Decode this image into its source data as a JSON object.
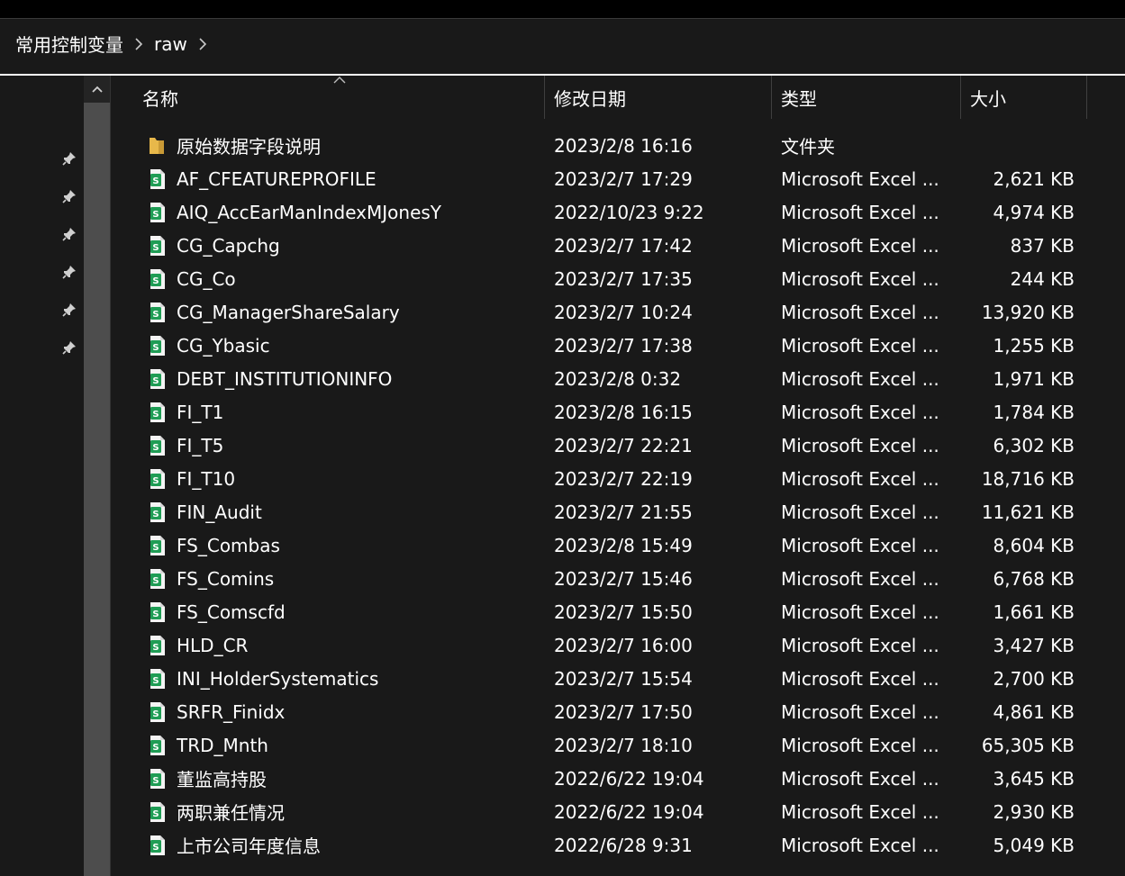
{
  "breadcrumb": {
    "items": [
      "常用控制变量",
      "raw"
    ]
  },
  "columns": {
    "name": "名称",
    "date": "修改日期",
    "type": "类型",
    "size": "大小"
  },
  "colors": {
    "background": "#191919",
    "excel_green": "#1f9d55",
    "folder_yellow": "#e8b84a"
  },
  "files": [
    {
      "name": "原始数据字段说明",
      "date": "2023/2/8 16:16",
      "type": "文件夹",
      "size": "",
      "icon": "folder-icon"
    },
    {
      "name": "AF_CFEATUREPROFILE",
      "date": "2023/2/7 17:29",
      "type": "Microsoft Excel ...",
      "size": "2,621 KB",
      "icon": "excel-file-icon"
    },
    {
      "name": "AIQ_AccEarManIndexMJonesY",
      "date": "2022/10/23 9:22",
      "type": "Microsoft Excel ...",
      "size": "4,974 KB",
      "icon": "excel-file-icon"
    },
    {
      "name": "CG_Capchg",
      "date": "2023/2/7 17:42",
      "type": "Microsoft Excel ...",
      "size": "837 KB",
      "icon": "excel-file-icon"
    },
    {
      "name": "CG_Co",
      "date": "2023/2/7 17:35",
      "type": "Microsoft Excel ...",
      "size": "244 KB",
      "icon": "excel-file-icon"
    },
    {
      "name": "CG_ManagerShareSalary",
      "date": "2023/2/7 10:24",
      "type": "Microsoft Excel ...",
      "size": "13,920 KB",
      "icon": "excel-file-icon"
    },
    {
      "name": "CG_Ybasic",
      "date": "2023/2/7 17:38",
      "type": "Microsoft Excel ...",
      "size": "1,255 KB",
      "icon": "excel-file-icon"
    },
    {
      "name": "DEBT_INSTITUTIONINFO",
      "date": "2023/2/8 0:32",
      "type": "Microsoft Excel ...",
      "size": "1,971 KB",
      "icon": "excel-file-icon"
    },
    {
      "name": "FI_T1",
      "date": "2023/2/8 16:15",
      "type": "Microsoft Excel ...",
      "size": "1,784 KB",
      "icon": "excel-file-icon"
    },
    {
      "name": "FI_T5",
      "date": "2023/2/7 22:21",
      "type": "Microsoft Excel ...",
      "size": "6,302 KB",
      "icon": "excel-file-icon"
    },
    {
      "name": "FI_T10",
      "date": "2023/2/7 22:19",
      "type": "Microsoft Excel ...",
      "size": "18,716 KB",
      "icon": "excel-file-icon"
    },
    {
      "name": "FIN_Audit",
      "date": "2023/2/7 21:55",
      "type": "Microsoft Excel ...",
      "size": "11,621 KB",
      "icon": "excel-file-icon"
    },
    {
      "name": "FS_Combas",
      "date": "2023/2/8 15:49",
      "type": "Microsoft Excel ...",
      "size": "8,604 KB",
      "icon": "excel-file-icon"
    },
    {
      "name": "FS_Comins",
      "date": "2023/2/7 15:46",
      "type": "Microsoft Excel ...",
      "size": "6,768 KB",
      "icon": "excel-file-icon"
    },
    {
      "name": "FS_Comscfd",
      "date": "2023/2/7 15:50",
      "type": "Microsoft Excel ...",
      "size": "1,661 KB",
      "icon": "excel-file-icon"
    },
    {
      "name": "HLD_CR",
      "date": "2023/2/7 16:00",
      "type": "Microsoft Excel ...",
      "size": "3,427 KB",
      "icon": "excel-file-icon"
    },
    {
      "name": "INI_HolderSystematics",
      "date": "2023/2/7 15:54",
      "type": "Microsoft Excel ...",
      "size": "2,700 KB",
      "icon": "excel-file-icon"
    },
    {
      "name": "SRFR_Finidx",
      "date": "2023/2/7 17:50",
      "type": "Microsoft Excel ...",
      "size": "4,861 KB",
      "icon": "excel-file-icon"
    },
    {
      "name": "TRD_Mnth",
      "date": "2023/2/7 18:10",
      "type": "Microsoft Excel ...",
      "size": "65,305 KB",
      "icon": "excel-file-icon"
    },
    {
      "name": "董监高持股",
      "date": "2022/6/22 19:04",
      "type": "Microsoft Excel ...",
      "size": "3,645 KB",
      "icon": "excel-file-icon"
    },
    {
      "name": "两职兼任情况",
      "date": "2022/6/22 19:04",
      "type": "Microsoft Excel ...",
      "size": "2,930 KB",
      "icon": "excel-file-icon"
    },
    {
      "name": "上市公司年度信息",
      "date": "2022/6/28 9:31",
      "type": "Microsoft Excel ...",
      "size": "5,049 KB",
      "icon": "excel-file-icon"
    }
  ]
}
